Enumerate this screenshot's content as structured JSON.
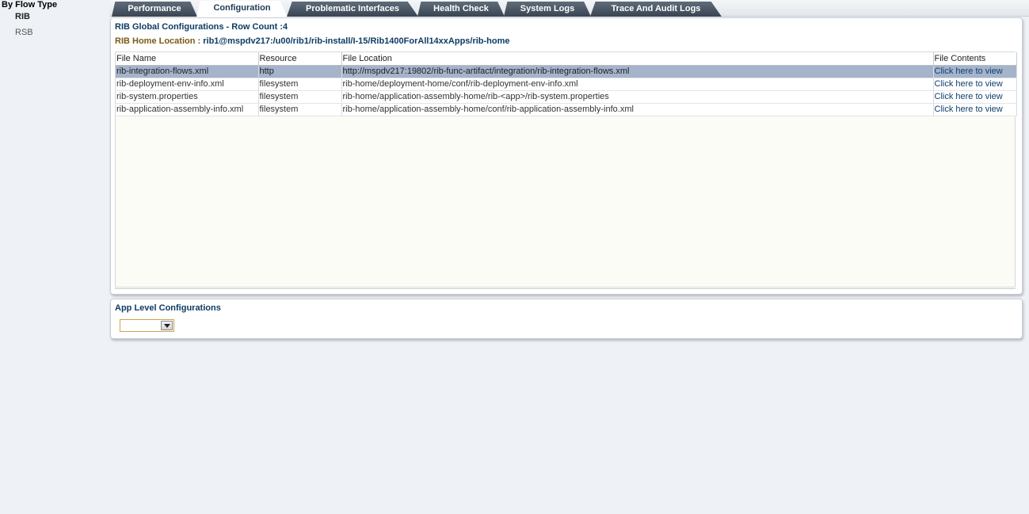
{
  "sidebar": {
    "title": "By Flow Type",
    "items": [
      {
        "label": "RIB",
        "selected": true
      },
      {
        "label": "RSB",
        "selected": false
      }
    ]
  },
  "tabs": [
    {
      "label": "Performance",
      "active": false
    },
    {
      "label": "Configuration",
      "active": true
    },
    {
      "label": "Problematic Interfaces",
      "active": false
    },
    {
      "label": "Health Check",
      "active": false
    },
    {
      "label": "System Logs",
      "active": false
    },
    {
      "label": "Trace And Audit Logs",
      "active": false
    }
  ],
  "global_config": {
    "title": "RIB Global Configurations - Row Count :4",
    "home_label": "RIB Home Location :",
    "home_value": "rib1@mspdv217:/u00/rib1/rib-install/I-15/Rib1400ForAll14xxApps/rib-home",
    "columns": [
      "File Name",
      "Resource",
      "File Location",
      "File Contents"
    ],
    "rows": [
      {
        "file_name": "rib-integration-flows.xml",
        "resource": "http",
        "location": "http://mspdv217:19802/rib-func-artifact/integration/rib-integration-flows.xml",
        "contents": "Click here to view",
        "selected": true
      },
      {
        "file_name": "rib-deployment-env-info.xml",
        "resource": "filesystem",
        "location": "rib-home/deployment-home/conf/rib-deployment-env-info.xml",
        "contents": "Click here to view",
        "selected": false
      },
      {
        "file_name": "rib-system.properties",
        "resource": "filesystem",
        "location": "rib-home/application-assembly-home/rib-<app>/rib-system.properties",
        "contents": "Click here to view",
        "selected": false
      },
      {
        "file_name": "rib-application-assembly-info.xml",
        "resource": "filesystem",
        "location": "rib-home/application-assembly-home/conf/rib-application-assembly-info.xml",
        "contents": "Click here to view",
        "selected": false
      }
    ]
  },
  "app_config": {
    "title": "App Level Configurations",
    "selected_value": ""
  },
  "colors": {
    "selected_row": "#a5b3cb",
    "title_blue": "#0d3c63",
    "label_gold": "#7a5a14"
  }
}
